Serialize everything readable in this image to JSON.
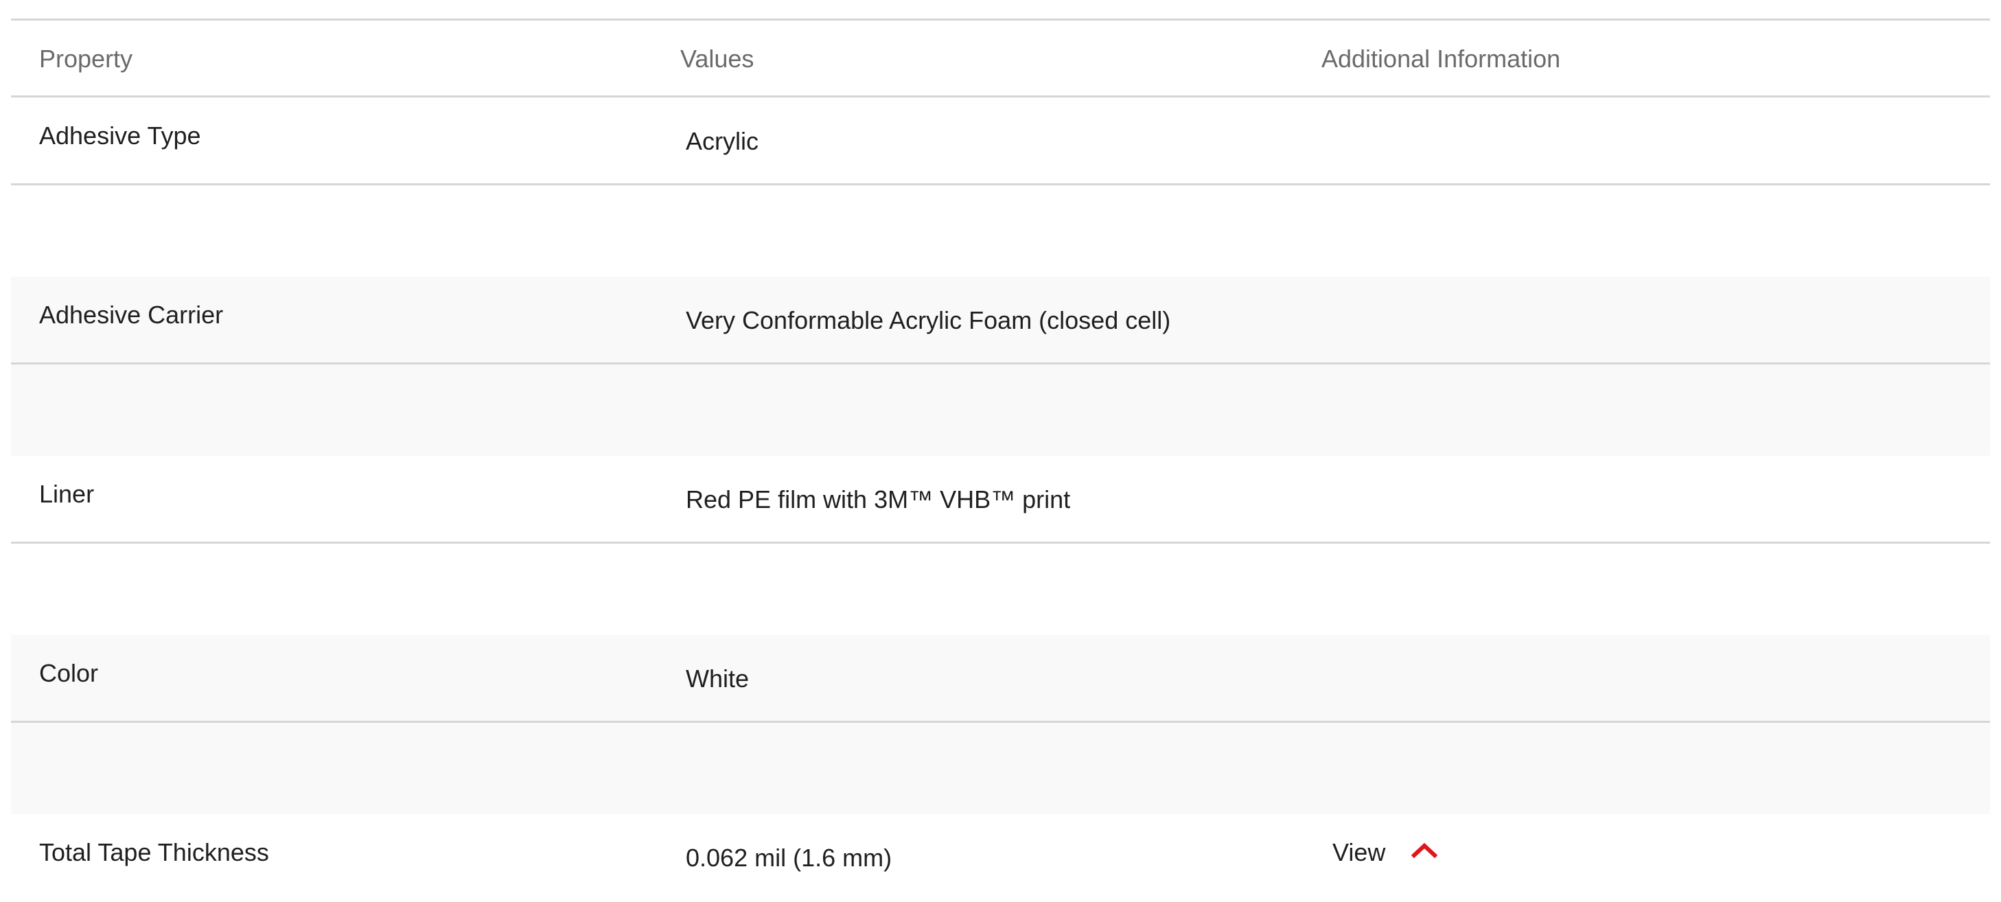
{
  "table": {
    "headers": {
      "property": "Property",
      "values": "Values",
      "additional": "Additional Information"
    },
    "rows": [
      {
        "property": "Adhesive Type",
        "value": "Acrylic",
        "info": ""
      },
      {
        "property": "Adhesive Carrier",
        "value": "Very Conformable Acrylic Foam (closed cell)",
        "info": ""
      },
      {
        "property": "Liner",
        "value": "Red PE film with 3M™ VHB™ print",
        "info": ""
      },
      {
        "property": "Color",
        "value": "White",
        "info": ""
      },
      {
        "property": "Total Tape Thickness",
        "value": "0.062 mil (1.6 mm)",
        "info": "View",
        "info_icon": "chevron-up-icon"
      }
    ]
  },
  "colors": {
    "accent": "#e1161c",
    "divider": "#d6d6d6",
    "header_text": "#6a6a6a",
    "body_text": "#1f1f1f",
    "shaded_row": "#f9f9f9"
  }
}
